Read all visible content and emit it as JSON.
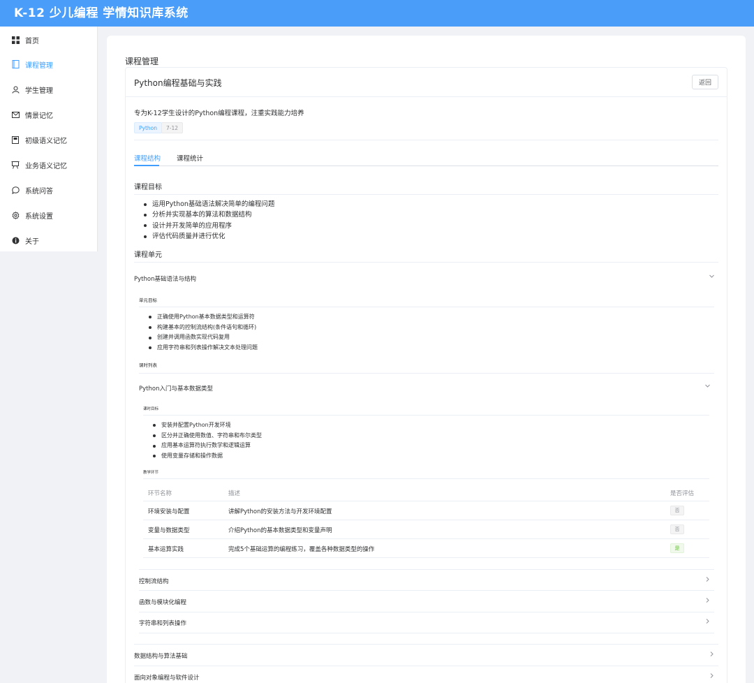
{
  "app": {
    "title": "K-12 少儿编程 学情知识库系统"
  },
  "sidebar": {
    "items": [
      {
        "label": "首页",
        "icon": "dashboard-icon"
      },
      {
        "label": "课程管理",
        "icon": "book-icon"
      },
      {
        "label": "学生管理",
        "icon": "user-icon"
      },
      {
        "label": "情景记忆",
        "icon": "mail-icon"
      },
      {
        "label": "初级语义记忆",
        "icon": "notebook-icon"
      },
      {
        "label": "业务语义记忆",
        "icon": "presentation-icon"
      },
      {
        "label": "系统问答",
        "icon": "chat-icon"
      },
      {
        "label": "系统设置",
        "icon": "gear-icon"
      },
      {
        "label": "关于",
        "icon": "info-icon"
      }
    ],
    "active_index": 1
  },
  "page": {
    "title": "课程管理"
  },
  "course": {
    "name": "Python编程基础与实践",
    "back_label": "返回",
    "description": "专为K-12学生设计的Python编程课程，注重实践能力培养",
    "tags": [
      "Python",
      "7-12"
    ]
  },
  "tabs": [
    {
      "label": "课程结构"
    },
    {
      "label": "课程统计"
    }
  ],
  "objectives": {
    "title": "课程目标",
    "items": [
      "运用Python基础语法解决简单的编程问题",
      "分析并实现基本的算法和数据结构",
      "设计并开发简单的应用程序",
      "评估代码质量并进行优化"
    ]
  },
  "units": {
    "title": "课程单元",
    "list": [
      {
        "name": "Python基础语法与结构"
      },
      {
        "name": "数据结构与算法基础"
      },
      {
        "name": "面向对象编程与软件设计"
      }
    ]
  },
  "unit1": {
    "goals_label": "单元目标",
    "goals": [
      "正确使用Python基本数据类型和运算符",
      "构建基本的控制流结构(条件语句和循环)",
      "创建并调用函数实现代码复用",
      "应用字符串和列表操作解决文本处理问题"
    ],
    "lessons_label": "课时列表",
    "lessons": [
      {
        "name": "Python入门与基本数据类型"
      },
      {
        "name": "控制流结构"
      },
      {
        "name": "函数与模块化编程"
      },
      {
        "name": "字符串和列表操作"
      }
    ]
  },
  "lesson1": {
    "goals_label": "课时目标",
    "goals": [
      "安装并配置Python开发环境",
      "区分并正确使用数值、字符串和布尔类型",
      "应用基本运算符执行数学和逻辑运算",
      "使用变量存储和操作数据"
    ],
    "sections_label": "教学环节",
    "table": {
      "headers": [
        "环节名称",
        "描述",
        "是否评估"
      ],
      "rows": [
        {
          "name": "环境安装与配置",
          "desc": "讲解Python的安装方法与开发环境配置",
          "eval": "否"
        },
        {
          "name": "变量与数据类型",
          "desc": "介绍Python的基本数据类型和变量声明",
          "eval": "否"
        },
        {
          "name": "基本运算实践",
          "desc": "完成5个基础运算的编程练习，覆盖各种数据类型的操作",
          "eval": "是"
        }
      ]
    }
  },
  "colors": {
    "header": "#4a9df8",
    "accent": "#409eff",
    "success": "#67c23a"
  }
}
